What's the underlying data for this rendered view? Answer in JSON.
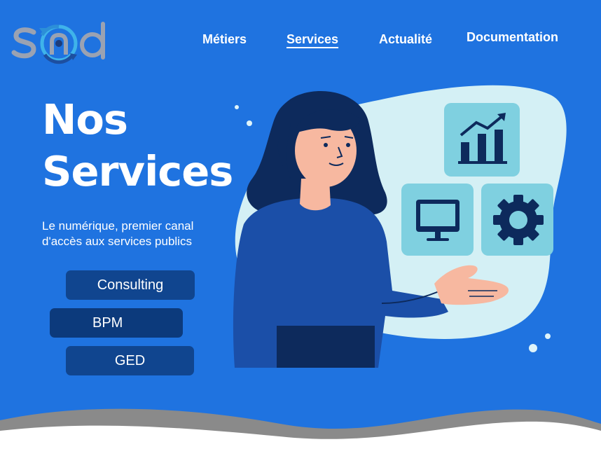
{
  "brand": {
    "logo_text": "snd"
  },
  "nav": {
    "items": [
      {
        "label": "Métiers",
        "active": false
      },
      {
        "label": "Services",
        "active": true
      },
      {
        "label": "Actualité",
        "active": false
      },
      {
        "label": "Documentation",
        "active": false
      }
    ]
  },
  "hero": {
    "title_line1": "Nos",
    "title_line2": "Services",
    "subtitle_line1": "Le numérique, premier canal",
    "subtitle_line2": "d'accès aux services publics"
  },
  "services": [
    {
      "label": "Consulting"
    },
    {
      "label": "BPM"
    },
    {
      "label": "GED"
    }
  ],
  "illustration": {
    "icons": [
      "chart-icon",
      "monitor-icon",
      "gear-icon"
    ]
  },
  "colors": {
    "background": "#1f73e0",
    "button_dark": "#10458f",
    "blob_light": "#d4f0f5",
    "tile": "#7fd0e0",
    "icon_navy": "#0d2a5c",
    "wave_gray": "#8a8a8a"
  }
}
